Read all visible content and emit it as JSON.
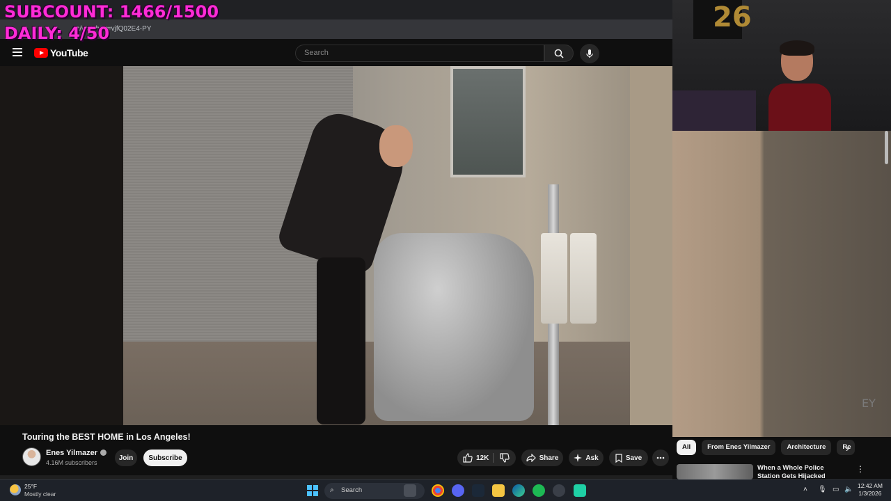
{
  "overlay": {
    "subcount": "SUBCOUNT: 1466/1500",
    "daily": "DAILY: 4/50"
  },
  "browser": {
    "url_visible": "m/watch?v=vjfQ02E4-PY"
  },
  "youtube": {
    "logo_text": "YouTube",
    "search_placeholder": "Search"
  },
  "video": {
    "title": "Touring the BEST HOME in Los Angeles!",
    "channel": "Enes Yilmazer",
    "subscribers": "4.16M subscribers",
    "join_label": "Join",
    "subscribe_label": "Subscribe",
    "like_count": "12K",
    "share_label": "Share",
    "ask_label": "Ask",
    "save_label": "Save",
    "watermark": "EY"
  },
  "webcam": {
    "balloon_text": "26"
  },
  "sidebar": {
    "chips": [
      "All",
      "From Enes Yilmazer",
      "Architecture",
      "Re"
    ],
    "recommendation_title": "When a Whole Police Station Gets Hijacked"
  },
  "taskbar": {
    "temperature": "25°F",
    "condition": "Mostly clear",
    "search_label": "Search",
    "time": "12:42 AM",
    "date": "1/3/2026"
  },
  "colors": {
    "overlay_text": "#ff2bd6",
    "youtube_red": "#ff0000",
    "windows_accent": "#4cc2ff"
  }
}
